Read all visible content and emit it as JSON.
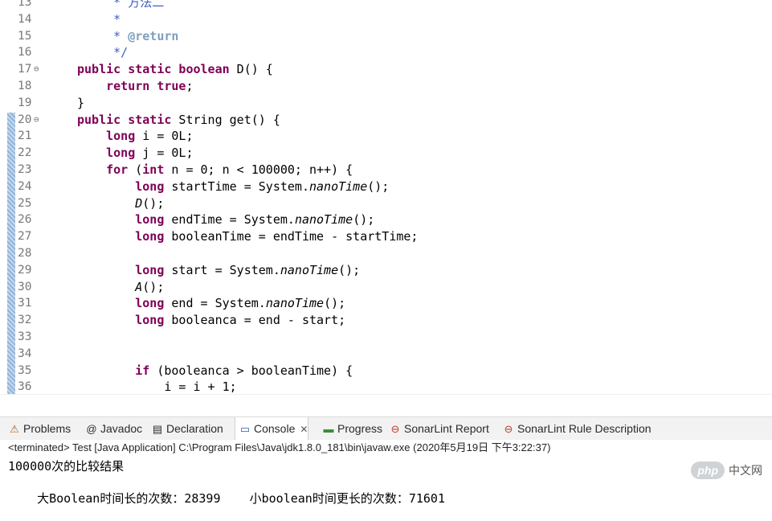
{
  "editor": {
    "lines": [
      {
        "num": "13",
        "fold": "",
        "html": "<span class='cm'>     * 方法二</span>"
      },
      {
        "num": "14",
        "fold": "",
        "html": "<span class='cm'>     *</span>"
      },
      {
        "num": "15",
        "fold": "",
        "html": "<span class='cm'>     * </span><span class='tag'>@return</span>"
      },
      {
        "num": "16",
        "fold": "",
        "html": "<span class='cm'>     */</span>"
      },
      {
        "num": "17",
        "fold": "⊖",
        "html": "<span class='kw'>public static boolean</span> D() {"
      },
      {
        "num": "18",
        "fold": "",
        "html": "    <span class='kw'>return true</span>;"
      },
      {
        "num": "19",
        "fold": "",
        "html": "}"
      },
      {
        "num": "20",
        "fold": "⊖",
        "html": "<span class='kw'>public static</span> String get() {"
      },
      {
        "num": "21",
        "fold": "",
        "html": "    <span class='kw'>long</span> i = 0L;"
      },
      {
        "num": "22",
        "fold": "",
        "html": "    <span class='kw'>long</span> j = 0L;"
      },
      {
        "num": "23",
        "fold": "",
        "html": "    <span class='kw'>for</span> (<span class='kw'>int</span> n = 0; n &lt; 100000; n++) {"
      },
      {
        "num": "24",
        "fold": "",
        "html": "        <span class='kw'>long</span> startTime = System.<span class='it'>nanoTime</span>();"
      },
      {
        "num": "25",
        "fold": "",
        "html": "        <span class='it'>D</span>();"
      },
      {
        "num": "26",
        "fold": "",
        "html": "        <span class='kw'>long</span> endTime = System.<span class='it'>nanoTime</span>();"
      },
      {
        "num": "27",
        "fold": "",
        "html": "        <span class='kw'>long</span> booleanTime = endTime - startTime;"
      },
      {
        "num": "28",
        "fold": "",
        "html": ""
      },
      {
        "num": "29",
        "fold": "",
        "html": "        <span class='kw'>long</span> start = System.<span class='it'>nanoTime</span>();"
      },
      {
        "num": "30",
        "fold": "",
        "html": "        <span class='it'>A</span>();"
      },
      {
        "num": "31",
        "fold": "",
        "html": "        <span class='kw'>long</span> end = System.<span class='it'>nanoTime</span>();"
      },
      {
        "num": "32",
        "fold": "",
        "html": "        <span class='kw'>long</span> booleanca = end - start;"
      },
      {
        "num": "33",
        "fold": "",
        "html": ""
      },
      {
        "num": "34",
        "fold": "",
        "html": ""
      },
      {
        "num": "35",
        "fold": "",
        "html": "        <span class='kw'>if</span> (booleanca &gt; booleanTime) {"
      },
      {
        "num": "36",
        "fold": "",
        "html": "            i = i + 1;"
      }
    ]
  },
  "tabs": [
    {
      "icon": "problems-icon",
      "glyph": "⚠",
      "label": "Problems",
      "active": false
    },
    {
      "icon": "javadoc-icon",
      "glyph": "@",
      "label": "Javadoc",
      "active": false
    },
    {
      "icon": "declaration-icon",
      "glyph": "▤",
      "label": "Declaration",
      "active": false
    },
    {
      "icon": "console-icon",
      "glyph": "▭",
      "label": "Console",
      "active": true,
      "close": "✕"
    },
    {
      "icon": "progress-icon",
      "glyph": "▬",
      "label": "Progress",
      "active": false
    },
    {
      "icon": "sonarlint-icon",
      "glyph": "⊖",
      "label": "SonarLint Report",
      "active": false
    },
    {
      "icon": "sonarlint-rule-icon",
      "glyph": "⊖",
      "label": "SonarLint Rule Description",
      "active": false
    }
  ],
  "console": {
    "status": "<terminated> Test [Java Application] C:\\Program Files\\Java\\jdk1.8.0_181\\bin\\javaw.exe (2020年5月19日 下午3:22:37)",
    "output_line1": "100000次的比较结果",
    "output_line2_a": "大Boolean时间长的次数：28399",
    "output_line2_b": "小boolean时间更长的次数：71601"
  },
  "watermark": {
    "badge": "php",
    "text": "中文网"
  },
  "colors": {
    "keyword": "#7f0055",
    "comment": "#3f5fbf",
    "javadoc_tag": "#7f9fbf",
    "line_number": "#787878"
  }
}
